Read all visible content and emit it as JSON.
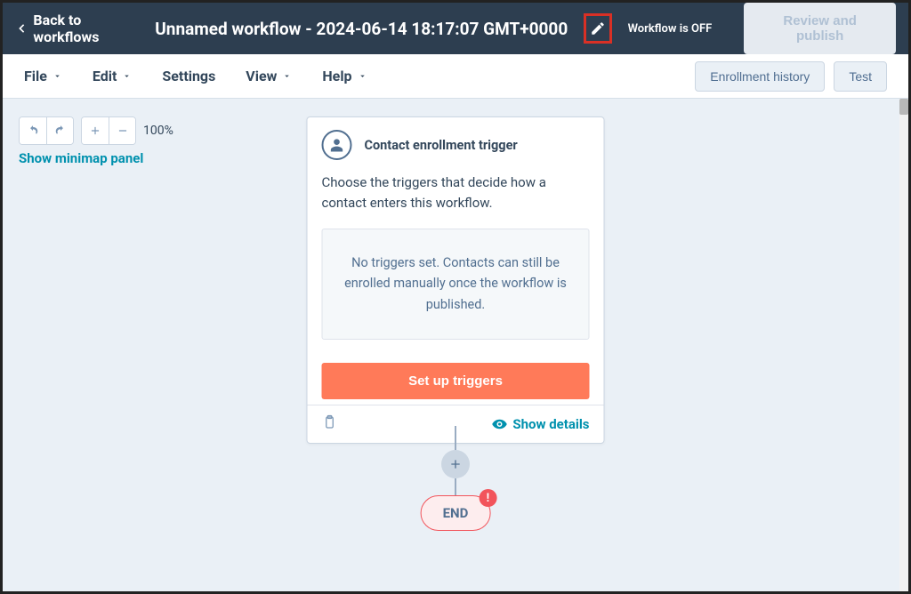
{
  "header": {
    "back_label": "Back to workflows",
    "title": "Unnamed workflow - 2024-06-14 18:17:07 GMT+0000",
    "status": "Workflow is OFF",
    "review_label": "Review and publish"
  },
  "menu": {
    "file": "File",
    "edit": "Edit",
    "settings": "Settings",
    "view": "View",
    "help": "Help",
    "enrollment_history": "Enrollment history",
    "test": "Test"
  },
  "canvas": {
    "zoom": "100%",
    "minimap": "Show minimap panel",
    "plus_label": "+",
    "end_label": "END",
    "end_alert": "!"
  },
  "card": {
    "title": "Contact enrollment trigger",
    "description": "Choose the triggers that decide how a contact enters this workflow.",
    "empty": "No triggers set. Contacts can still be enrolled manually once the workflow is published.",
    "setup_label": "Set up triggers",
    "show_details": "Show details"
  }
}
